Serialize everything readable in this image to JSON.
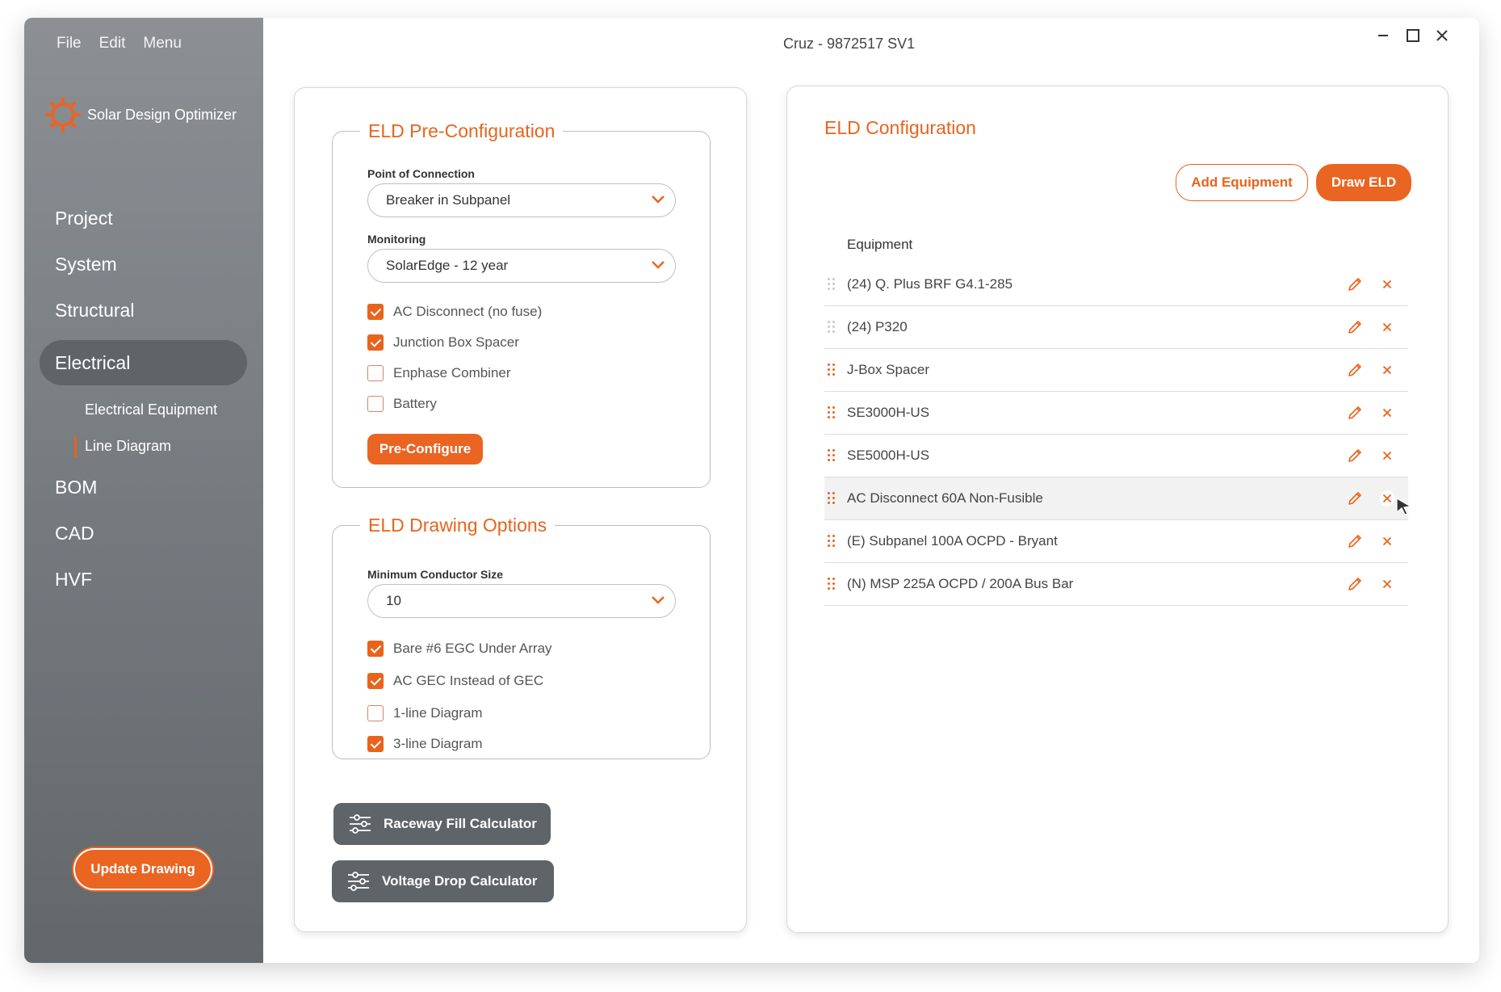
{
  "menu": [
    "File",
    "Edit",
    "Menu"
  ],
  "app_name": "Solar Design Optimizer",
  "window_title": "Cruz - 9872517 SV1",
  "nav": {
    "project": "Project",
    "system": "System",
    "structural": "Structural",
    "electrical": "Electrical",
    "electrical_equipment": "Electrical Equipment",
    "line_diagram": "Line Diagram",
    "bom": "BOM",
    "cad": "CAD",
    "hvf": "HVF"
  },
  "update_drawing": "Update Drawing",
  "preconfig": {
    "title": "ELD Pre-Configuration",
    "poc_label": "Point of Connection",
    "poc_value": "Breaker in Subpanel",
    "monitoring_label": "Monitoring",
    "monitoring_value": "SolarEdge - 12 year",
    "checks": [
      {
        "label": "AC Disconnect (no fuse)",
        "checked": true
      },
      {
        "label": "Junction Box Spacer",
        "checked": true
      },
      {
        "label": "Enphase Combiner",
        "checked": false
      },
      {
        "label": "Battery",
        "checked": false
      }
    ],
    "button": "Pre-Configure"
  },
  "drawing_options": {
    "title": "ELD Drawing Options",
    "conductor_label": "Minimum Conductor Size",
    "conductor_value": "10",
    "checks": [
      {
        "label": "Bare #6 EGC Under Array",
        "checked": true
      },
      {
        "label": "AC GEC Instead of GEC",
        "checked": true
      },
      {
        "label": "1-line Diagram",
        "checked": false
      },
      {
        "label": "3-line Diagram",
        "checked": true
      }
    ]
  },
  "calculators": {
    "raceway": "Raceway Fill Calculator",
    "voltage": "Voltage Drop Calculator"
  },
  "eld_config": {
    "title": "ELD Configuration",
    "add_equipment": "Add Equipment",
    "draw_eld": "Draw ELD",
    "equipment_header": "Equipment",
    "items": [
      "(24) Q. Plus BRF G4.1-285",
      "(24) P320",
      "J-Box Spacer",
      "SE3000H-US",
      "SE5000H-US",
      "AC Disconnect 60A Non-Fusible",
      "(E) Subpanel 100A OCPD - Bryant",
      "(N) MSP 225A OCPD / 200A Bus Bar"
    ]
  },
  "colors": {
    "accent": "#e8641c",
    "sidebar": "#74797e",
    "dark_button": "#5f6469"
  }
}
